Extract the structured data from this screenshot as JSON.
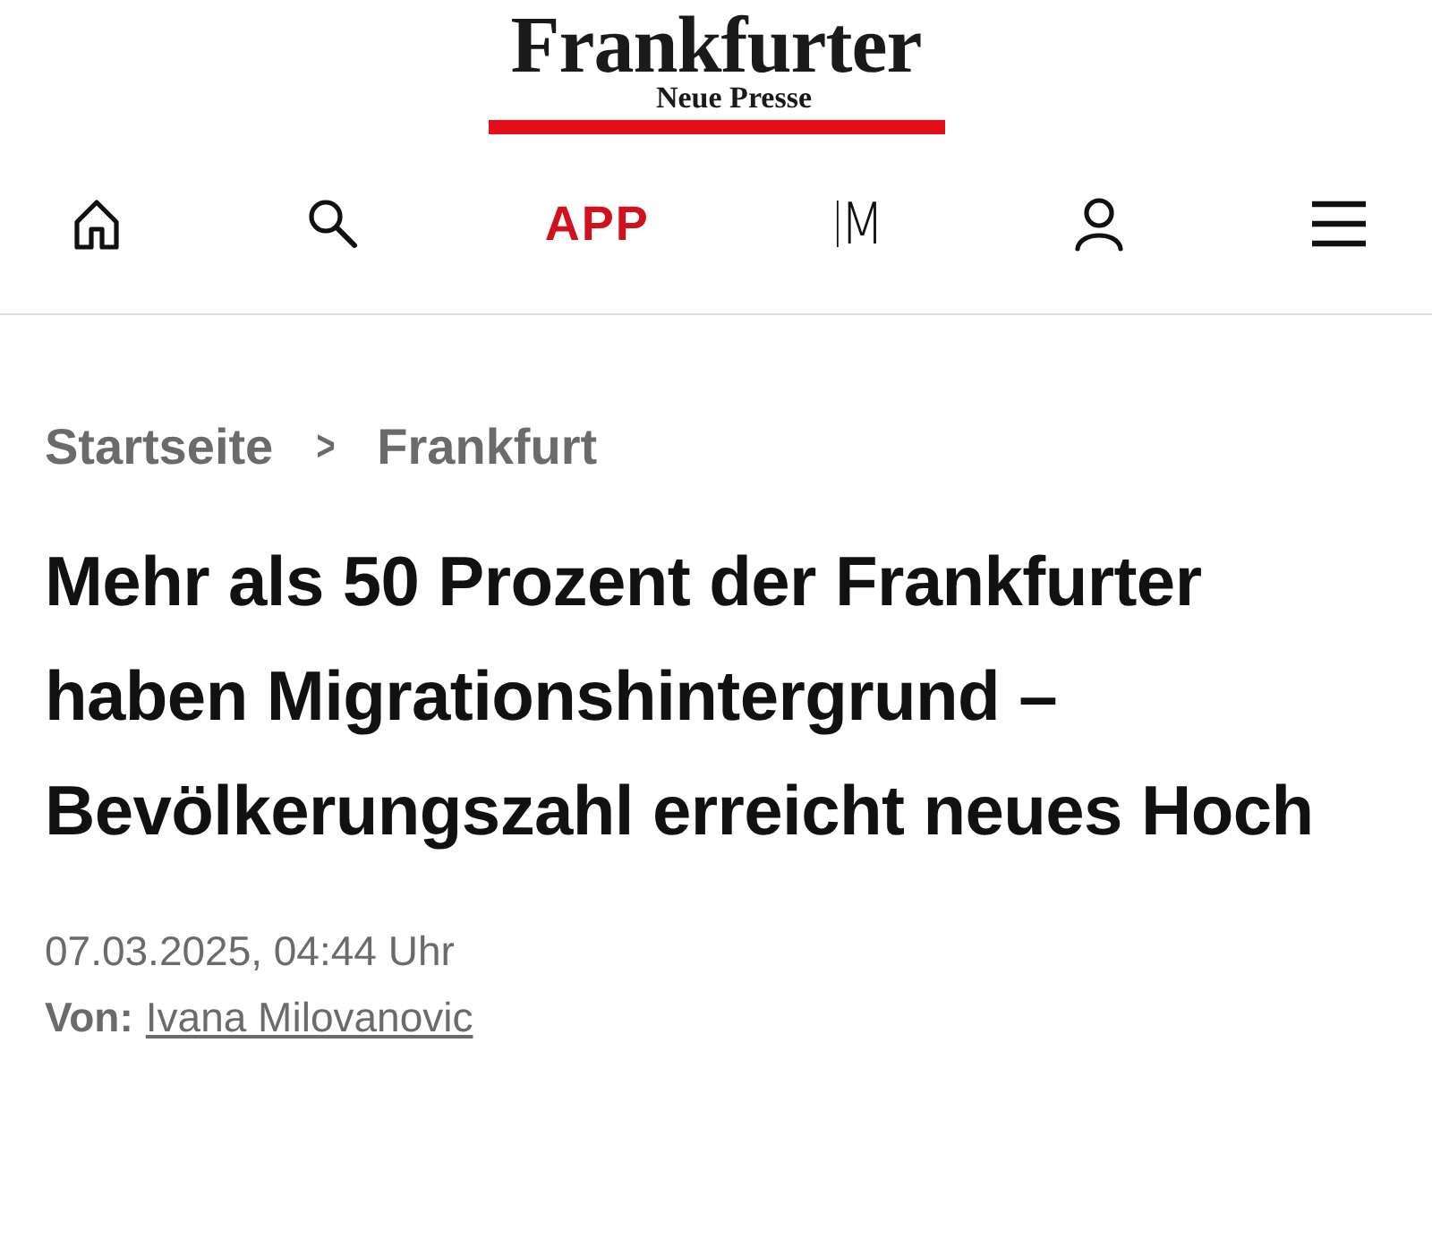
{
  "logo": {
    "title": "Frankfurter",
    "subtitle": "Neue Presse"
  },
  "nav": {
    "app_label": "APP",
    "m_label": "M"
  },
  "breadcrumb": [
    {
      "label": "Startseite"
    },
    {
      "label": "Frankfurt"
    }
  ],
  "breadcrumb_separator": ">",
  "headline": "Mehr als 50 Prozent der Frankfurter haben Migrationshintergrund – Bevölkerungszahl erreicht neues Hoch",
  "date": "07.03.2025, 04:44 Uhr",
  "author": {
    "prefix": "Von:",
    "name": "Ivana Milovanovic"
  }
}
